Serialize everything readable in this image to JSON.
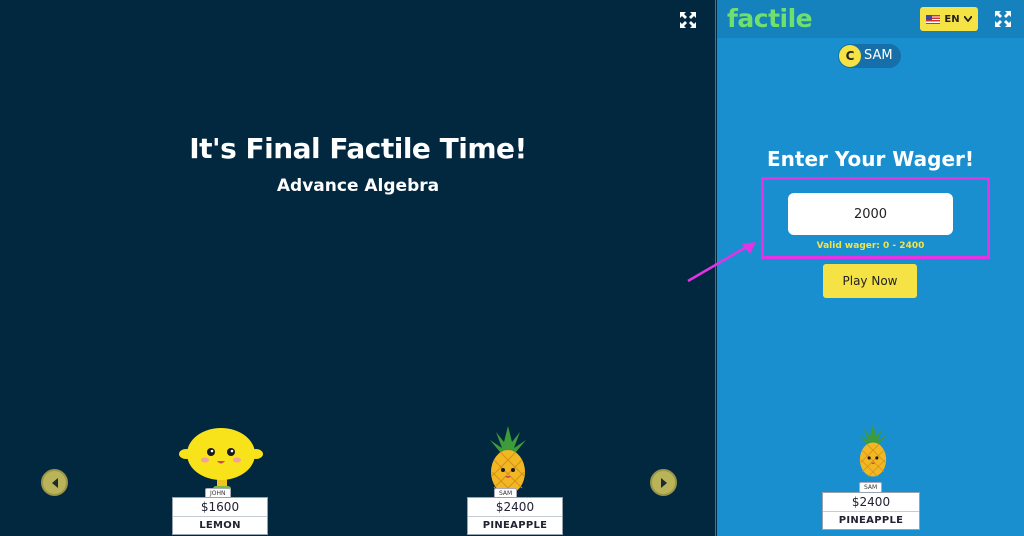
{
  "stage": {
    "title": "It's Final Factile Time!",
    "subtitle": "Advance Algebra",
    "players": [
      {
        "name": "JOHN",
        "score": "$1600",
        "team": "LEMON"
      },
      {
        "name": "SAM",
        "score": "$2400",
        "team": "PINEAPPLE"
      }
    ]
  },
  "panel": {
    "logo": "factile",
    "language": "EN",
    "user": {
      "initial": "C",
      "name": "SAM"
    },
    "wager_title": "Enter Your Wager!",
    "wager_value": "2000",
    "wager_hint": "Valid wager: 0 - 2400",
    "play_button": "Play Now",
    "player": {
      "name": "SAM",
      "score": "$2400",
      "team": "PINEAPPLE"
    }
  },
  "colors": {
    "stage_bg": "#02283f",
    "panel_bg": "#1a8fd0",
    "accent_yellow": "#f5e346",
    "logo_green": "#6fe06b",
    "highlight_magenta": "#e432e4"
  },
  "icons": [
    "expand-icon",
    "chevron-left-icon",
    "chevron-right-icon",
    "us-flag-icon",
    "chevron-down-icon",
    "lemon-character-icon",
    "pineapple-character-icon"
  ]
}
